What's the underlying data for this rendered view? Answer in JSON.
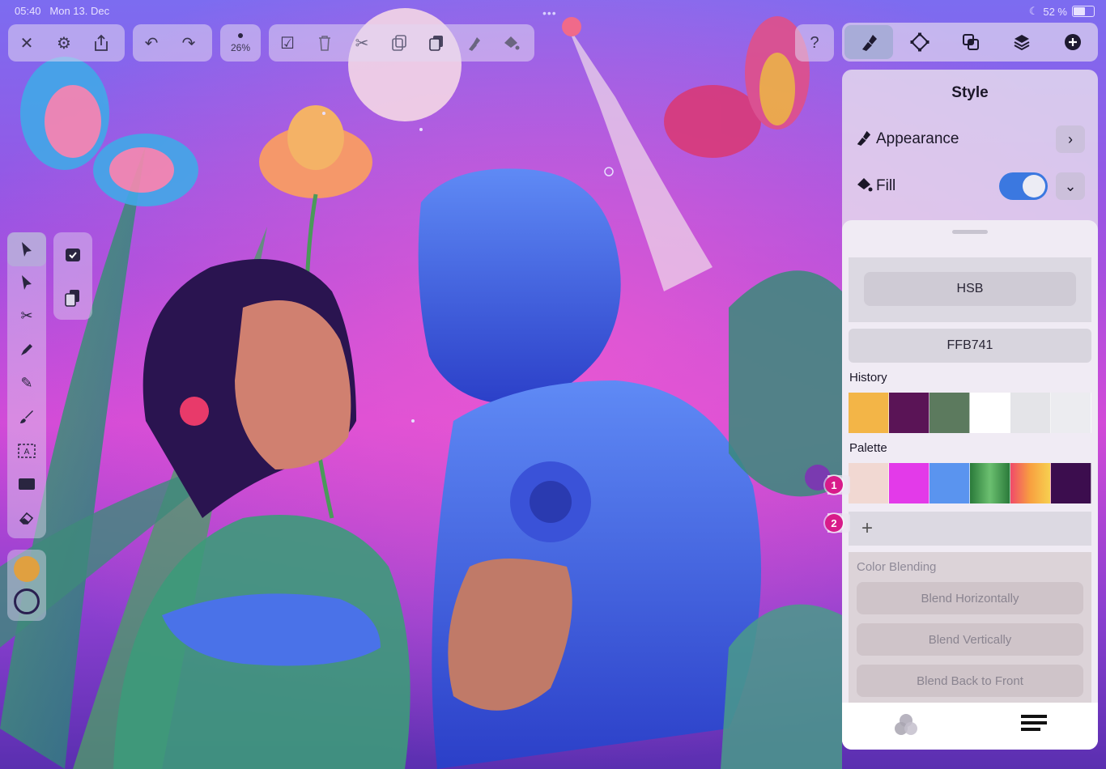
{
  "status": {
    "time": "05:40",
    "date": "Mon 13. Dec",
    "battery": "52 %"
  },
  "toolbar": {
    "zoom": "26%",
    "left_group": [
      "close-icon",
      "settings-icon",
      "share-icon"
    ],
    "undo_group": [
      "undo-icon",
      "redo-icon"
    ],
    "edit_group": [
      "select-all-icon",
      "trash-icon",
      "scissors-icon",
      "copy-icon",
      "paste-icon",
      "paste-style-icon",
      "fill-bucket-icon"
    ],
    "help": "?"
  },
  "right_tabs": [
    "style-icon",
    "shape-diamond-icon",
    "boolean-icon",
    "layers-icon",
    "add-icon"
  ],
  "panel": {
    "title": "Style",
    "appearance": "Appearance",
    "fill": "Fill",
    "fill_enabled": true
  },
  "color": {
    "mode": "HSB",
    "hex": "FFB741",
    "history_label": "History",
    "history": [
      "#f3b547",
      "#5a1456",
      "#5c7a5e",
      "#ffffff",
      "#e4e4e8",
      "#ececf0"
    ],
    "palette_label": "Palette",
    "palette": [
      "#f1d8d2",
      "#e33ae9",
      "#5a94ef",
      "linear-gradient(90deg,#2a7a3a,#6cc070,#2a7a3a)",
      "linear-gradient(90deg,#f04a6a,#f8a040,#f7d050)",
      "#3c0d4e"
    ],
    "add_label": "+"
  },
  "blending": {
    "title": "Color Blending",
    "horizontal": "Blend Horizontally",
    "vertical": "Blend Vertically",
    "back_to_front": "Blend Back to Front"
  },
  "badges": [
    "1",
    "2"
  ],
  "tools": [
    "select-arrow-icon",
    "direct-select-icon",
    "scissors-icon",
    "brush-icon",
    "pencil-icon",
    "vector-brush-icon",
    "text-icon",
    "shape-rect-icon",
    "eraser-icon"
  ],
  "accent": "#3b78e0",
  "fill_color": "#e0a040"
}
